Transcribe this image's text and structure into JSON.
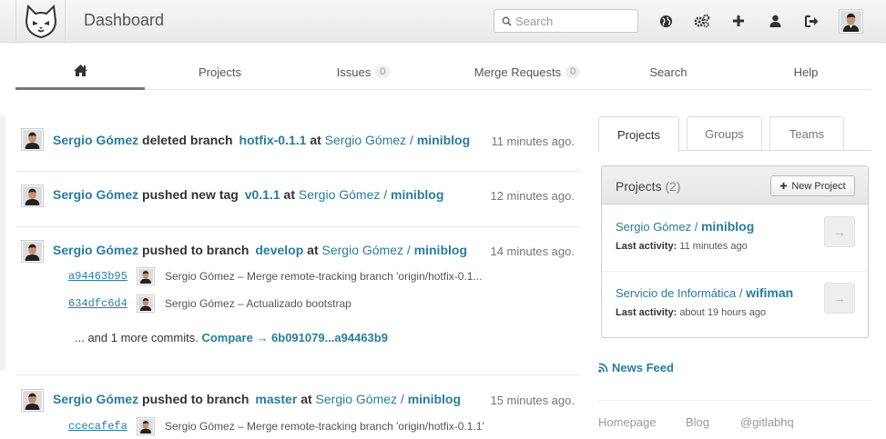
{
  "header": {
    "title": "Dashboard",
    "search_placeholder": "Search",
    "icons": [
      "globe-icon",
      "cogs-icon",
      "plus-icon",
      "user-icon",
      "sign-out-icon"
    ]
  },
  "nav": {
    "home_icon": "home-icon",
    "projects": "Projects",
    "issues": "Issues",
    "issues_count": "0",
    "merge_requests": "Merge Requests",
    "merge_requests_count": "0",
    "search": "Search",
    "help": "Help"
  },
  "events": [
    {
      "author": "Sergio Gómez",
      "action": "deleted branch",
      "ref": "hotfix-0.1.1",
      "at": "at",
      "project_owner": "Sergio Gómez / ",
      "project": "miniblog",
      "time": "11 minutes ago."
    },
    {
      "author": "Sergio Gómez",
      "action": "pushed new tag",
      "ref": "v0.1.1",
      "at": "at",
      "project_owner": "Sergio Gómez / ",
      "project": "miniblog",
      "time": "12 minutes ago."
    },
    {
      "author": "Sergio Gómez",
      "action": "pushed to branch",
      "ref": "develop",
      "at": "at",
      "project_owner": "Sergio Gómez / ",
      "project": "miniblog",
      "time": "14 minutes ago.",
      "commits": [
        {
          "sha": "a94463b95",
          "message": "Sergio Gómez – Merge remote-tracking branch 'origin/hotfix-0.1..."
        },
        {
          "sha": "634dfc6d4",
          "message": "Sergio Gómez – Actualizado bootstrap"
        }
      ],
      "more_text": "... and 1 more commits.",
      "compare": "Compare → 6b091079...a94463b9"
    },
    {
      "author": "Sergio Gómez",
      "action": "pushed to branch",
      "ref": "master",
      "at": "at",
      "project_owner": "Sergio Gómez / ",
      "project": "miniblog",
      "time": "15 minutes ago.",
      "commits": [
        {
          "sha": "ccecafefa",
          "message": "Sergio Gómez – Merge remote-tracking branch 'origin/hotfix-0.1.1'"
        }
      ]
    }
  ],
  "sidebar": {
    "tabs": [
      "Projects",
      "Groups",
      "Teams"
    ],
    "panel_title": "Projects",
    "panel_count": "(2)",
    "new_project": "New Project",
    "projects": [
      {
        "owner": "Sergio Gómez / ",
        "name": "miniblog",
        "last_activity_label": "Last activity:",
        "last_activity": "11 minutes ago"
      },
      {
        "owner": "Servicio de Informática / ",
        "name": "wifiman",
        "last_activity_label": "Last activity:",
        "last_activity": "about 19 hours ago"
      }
    ],
    "arrow": "→",
    "news_feed": "News Feed",
    "footer": [
      "Homepage",
      "Blog",
      "@gitlabhq"
    ]
  }
}
